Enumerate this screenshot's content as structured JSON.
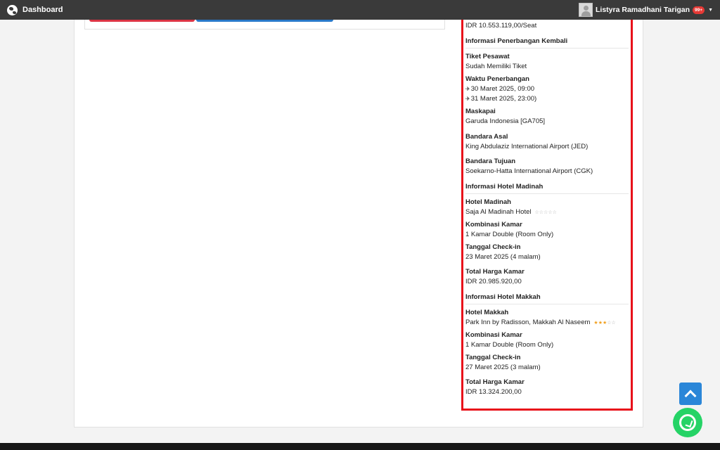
{
  "nav": {
    "brand": "Dashboard",
    "user_name": "Listyra Ramadhani Tarigan",
    "notif_badge": "99+"
  },
  "summary": {
    "price_per_seat": "IDR 10.553.119,00/Seat",
    "return_flight": {
      "section_title": "Informasi Penerbangan Kembali",
      "ticket_label": "Tiket Pesawat",
      "ticket_value": "Sudah Memiliki Tiket",
      "time_label": "Waktu Penerbangan",
      "depart_time": "30 Maret 2025, 09:00",
      "arrive_time": "31 Maret 2025, 23:00)",
      "airline_label": "Maskapai",
      "airline_value": "Garuda Indonesia [GA705]",
      "origin_label": "Bandara Asal",
      "origin_value": "King Abdulaziz International Airport (JED)",
      "dest_label": "Bandara Tujuan",
      "dest_value": "Soekarno-Hatta International Airport (CGK)"
    },
    "hotel_madinah": {
      "section_title": "Informasi Hotel Madinah",
      "hotel_label": "Hotel Madinah",
      "hotel_value": "Saja Al Madinah Hotel",
      "rating": 0,
      "room_label": "Kombinasi Kamar",
      "room_value": "1 Kamar Double (Room Only)",
      "checkin_label": "Tanggal Check-in",
      "checkin_value": "23 Maret 2025 (4 malam)",
      "total_label": "Total Harga Kamar",
      "total_value": "IDR 20.985.920,00"
    },
    "hotel_makkah": {
      "section_title": "Informasi Hotel Makkah",
      "hotel_label": "Hotel Makkah",
      "hotel_value": "Park Inn by Radisson, Makkah Al Naseem",
      "rating": 3,
      "room_label": "Kombinasi Kamar",
      "room_value": "1 Kamar Double (Room Only)",
      "checkin_label": "Tanggal Check-in",
      "checkin_value": "27 Maret 2025 (3 malam)",
      "total_label": "Total Harga Kamar",
      "total_value": "IDR 13.324.200,00"
    }
  },
  "colors": {
    "highlight_border": "#e8101a",
    "scroll_button": "#2a86d8",
    "whatsapp": "#25d366"
  },
  "icons": {
    "brand": "globe-icon",
    "depart": "plane-takeoff-icon",
    "arrive": "plane-landing-icon",
    "scroll_top": "chevron-up-icon",
    "chat": "whatsapp-icon"
  }
}
